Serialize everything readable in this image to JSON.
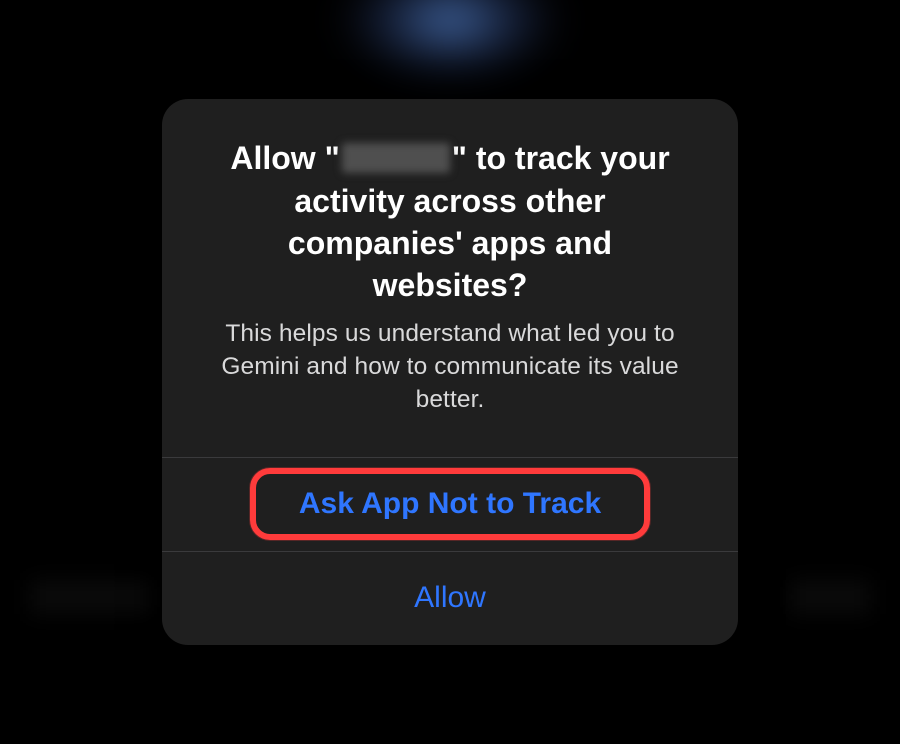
{
  "dialog": {
    "title_prefix": "Allow \"",
    "app_name_redacted": true,
    "title_suffix": "\" to track your",
    "title_line2": "activity across other",
    "title_line3": "companies' apps and",
    "title_line4": "websites?",
    "subtitle": "This helps us understand what led you to Gemini and how to communicate its value better.",
    "buttons": {
      "deny": "Ask App Not to Track",
      "allow": "Allow"
    },
    "highlighted_button": "deny"
  }
}
